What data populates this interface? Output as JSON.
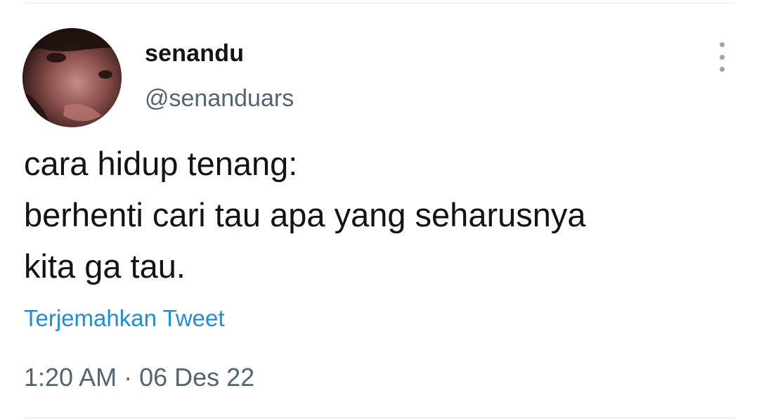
{
  "user": {
    "display_name": "senandu",
    "handle": "@senanduars"
  },
  "tweet": {
    "lines": [
      "cara hidup tenang:",
      "berhenti cari tau apa yang seharusnya",
      "kita ga tau."
    ],
    "translate_label": "Terjemahkan Tweet",
    "timestamp": "1:20 AM · 06 Des 22"
  },
  "icons": {
    "more": "more-vertical-icon"
  },
  "colors": {
    "text_primary": "#0f1419",
    "text_secondary": "#536471",
    "link": "#1d8fd6",
    "divider": "#e9ecee"
  }
}
